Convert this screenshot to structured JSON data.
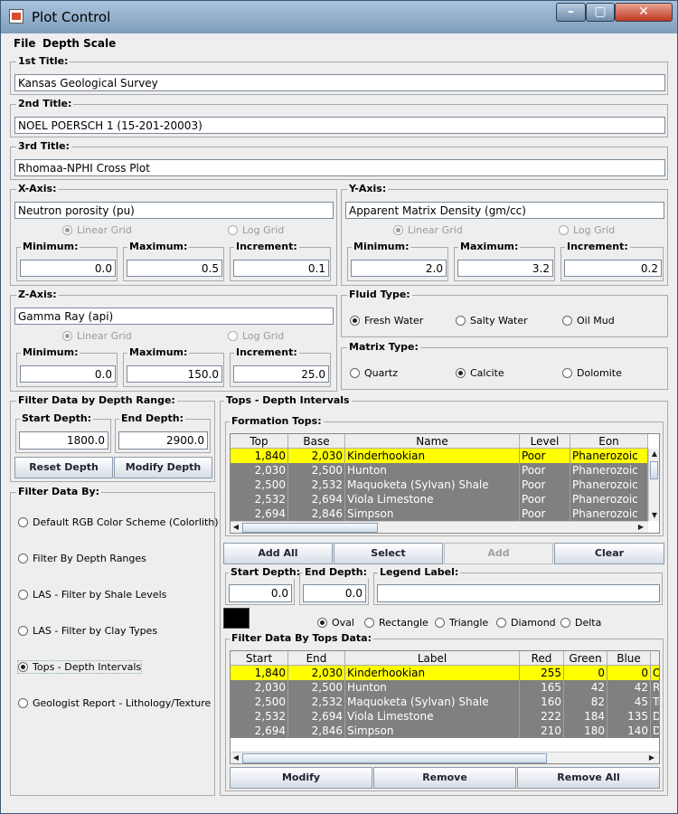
{
  "window": {
    "title": "Plot Control"
  },
  "menubar": {
    "file": "File",
    "depth_scale": "Depth Scale"
  },
  "titles": {
    "first_label": "1st Title:",
    "first_value": "Kansas Geological Survey",
    "second_label": "2nd Title:",
    "second_value": "NOEL POERSCH 1 (15-201-20003)",
    "third_label": "3rd Title:",
    "third_value": "Rhomaa-NPHI Cross Plot"
  },
  "x_axis": {
    "label": "X-Axis:",
    "value": "Neutron porosity (pu)",
    "linear": "Linear Grid",
    "log": "Log Grid",
    "min_label": "Minimum:",
    "min": "0.0",
    "max_label": "Maximum:",
    "max": "0.5",
    "inc_label": "Increment:",
    "inc": "0.1"
  },
  "y_axis": {
    "label": "Y-Axis:",
    "value": "Apparent Matrix Density (gm/cc)",
    "linear": "Linear Grid",
    "log": "Log Grid",
    "min_label": "Minimum:",
    "min": "2.0",
    "max_label": "Maximum:",
    "max": "3.2",
    "inc_label": "Increment:",
    "inc": "0.2"
  },
  "z_axis": {
    "label": "Z-Axis:",
    "value": "Gamma Ray (api)",
    "linear": "Linear Grid",
    "log": "Log Grid",
    "min_label": "Minimum:",
    "min": "0.0",
    "max_label": "Maximum:",
    "max": "150.0",
    "inc_label": "Increment:",
    "inc": "25.0"
  },
  "fluid": {
    "label": "Fluid Type:",
    "options": [
      "Fresh Water",
      "Salty Water",
      "Oil Mud"
    ]
  },
  "matrix": {
    "label": "Matrix Type:",
    "options": [
      "Quartz",
      "Calcite",
      "Dolomite"
    ]
  },
  "depth_filter": {
    "label": "Filter Data by Depth Range:",
    "start_label": "Start Depth:",
    "start": "1800.0",
    "end_label": "End Depth:",
    "end": "2900.0",
    "reset": "Reset Depth",
    "modify": "Modify Depth"
  },
  "filter_by": {
    "label": "Filter Data By:",
    "options": [
      "Default RGB Color Scheme (Colorlith)",
      "Filter By Depth Ranges",
      "LAS - Filter by Shale Levels",
      "LAS - Filter by Clay Types",
      "Tops - Depth Intervals",
      "Geologist Report - Lithology/Texture"
    ]
  },
  "tops": {
    "label": "Tops - Depth Intervals",
    "formation_label": "Formation Tops:",
    "columns": [
      "Top",
      "Base",
      "Name",
      "Level",
      "Eon"
    ],
    "rows": [
      [
        "1,840",
        "2,030",
        "Kinderhookian",
        "Poor",
        "Phanerozoic"
      ],
      [
        "2,030",
        "2,500",
        "Hunton",
        "Poor",
        "Phanerozoic"
      ],
      [
        "2,500",
        "2,532",
        "Maquoketa (Sylvan) Shale",
        "Poor",
        "Phanerozoic"
      ],
      [
        "2,532",
        "2,694",
        "Viola Limestone",
        "Poor",
        "Phanerozoic"
      ],
      [
        "2,694",
        "2,846",
        "Simpson",
        "Poor",
        "Phanerozoic"
      ]
    ],
    "add_all": "Add All",
    "select": "Select",
    "add": "Add",
    "clear": "Clear",
    "start_label": "Start Depth:",
    "start": "0.0",
    "end_label": "End Depth:",
    "end": "0.0",
    "legend_label": "Legend Label:",
    "legend_value": "",
    "shapes": [
      "Oval",
      "Rectangle",
      "Triangle",
      "Diamond",
      "Delta"
    ],
    "swatch_color": "#000000",
    "data_label": "Filter Data By Tops Data:",
    "data_columns": [
      "Start",
      "End",
      "Label",
      "Red",
      "Green",
      "Blue",
      ""
    ],
    "data_rows": [
      [
        "1,840",
        "2,030",
        "Kinderhookian",
        "255",
        "0",
        "0",
        "Or"
      ],
      [
        "2,030",
        "2,500",
        "Hunton",
        "165",
        "42",
        "42",
        "R"
      ],
      [
        "2,500",
        "2,532",
        "Maquoketa (Sylvan) Shale",
        "160",
        "82",
        "45",
        "Tr"
      ],
      [
        "2,532",
        "2,694",
        "Viola Limestone",
        "222",
        "184",
        "135",
        "D"
      ],
      [
        "2,694",
        "2,846",
        "Simpson",
        "210",
        "180",
        "140",
        "D"
      ]
    ],
    "modify": "Modify",
    "remove": "Remove",
    "remove_all": "Remove All"
  }
}
